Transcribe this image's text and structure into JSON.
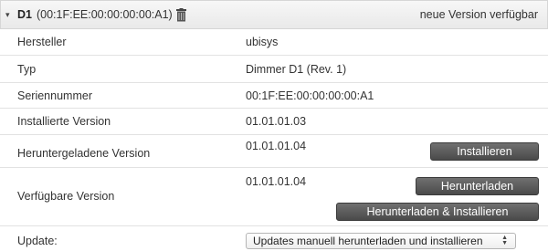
{
  "header": {
    "toggle_glyph": "▾",
    "device_name": "D1",
    "device_mac": "(00:1F:EE:00:00:00:00:A1)",
    "delete_icon": "trash-icon",
    "status": "neue Version verfügbar"
  },
  "rows": {
    "manufacturer": {
      "label": "Hersteller",
      "value": "ubisys"
    },
    "type": {
      "label": "Typ",
      "value": "Dimmer D1 (Rev. 1)"
    },
    "serial": {
      "label": "Seriennummer",
      "value": "00:1F:EE:00:00:00:00:A1"
    },
    "installed": {
      "label": "Installierte Version",
      "value": "01.01.01.03"
    },
    "downloaded": {
      "label": "Heruntergeladene Version",
      "value": "01.01.01.04",
      "install_button": "Installieren"
    },
    "available": {
      "label": "Verfügbare Version",
      "value": "01.01.01.04",
      "download_button": "Herunterladen",
      "download_install_button": "Herunterladen & Installieren"
    },
    "update": {
      "label": "Update:",
      "selected": "Updates manuell herunterladen und installieren",
      "select_arrows": "▲▼"
    }
  },
  "colors": {
    "button_bg": "#5a5a5a",
    "header_bg": "#efefef",
    "row_border": "#e2e2e2"
  }
}
